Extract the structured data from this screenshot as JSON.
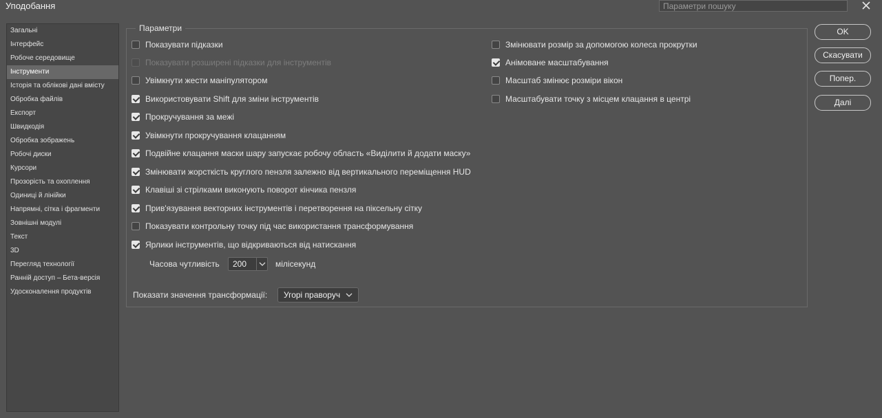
{
  "window": {
    "title": "Уподобання",
    "search_placeholder": "Параметри пошуку"
  },
  "sidebar": {
    "items": [
      {
        "label": "Загальні",
        "active": false
      },
      {
        "label": "Інтерфейс",
        "active": false
      },
      {
        "label": "Робоче середовище",
        "active": false
      },
      {
        "label": "Інструменти",
        "active": true
      },
      {
        "label": "Історія та облікові дані вмісту",
        "active": false
      },
      {
        "label": "Обробка файлів",
        "active": false
      },
      {
        "label": "Експорт",
        "active": false
      },
      {
        "label": "Швидкодія",
        "active": false
      },
      {
        "label": "Обробка зображень",
        "active": false
      },
      {
        "label": "Робочі диски",
        "active": false
      },
      {
        "label": "Курсори",
        "active": false
      },
      {
        "label": "Прозорість та охоплення",
        "active": false
      },
      {
        "label": "Одиниці й лінійки",
        "active": false
      },
      {
        "label": "Напрямні, сітка і фрагменти",
        "active": false
      },
      {
        "label": "Зовнішні модулі",
        "active": false
      },
      {
        "label": "Текст",
        "active": false
      },
      {
        "label": "3D",
        "active": false
      },
      {
        "label": "Перегляд технології",
        "active": false
      },
      {
        "label": "Ранній доступ – Бета-версія",
        "active": false
      },
      {
        "label": "Удосконалення продуктів",
        "active": false
      }
    ]
  },
  "options": {
    "group_title": "Параметри",
    "left": [
      {
        "label": "Показувати підказки",
        "checked": false,
        "disabled": false
      },
      {
        "label": "Показувати розширені підказки для інструментів",
        "checked": false,
        "disabled": true
      },
      {
        "label": "Увімкнути жести маніпулятором",
        "checked": false,
        "disabled": false
      },
      {
        "label": "Використовувати Shift для зміни інструментів",
        "checked": true,
        "disabled": false
      },
      {
        "label": "Прокручування за межі",
        "checked": true,
        "disabled": false
      },
      {
        "label": "Увімкнути прокручування клацанням",
        "checked": true,
        "disabled": false
      },
      {
        "label": "Подвійне клацання маски шару запускає робочу область «Виділити й додати маску»",
        "checked": true,
        "disabled": false
      },
      {
        "label": "Змінювати жорсткість круглого пензля залежно від вертикального переміщення HUD",
        "checked": true,
        "disabled": false
      },
      {
        "label": "Клавіші зі стрілками виконують поворот кінчика пензля",
        "checked": true,
        "disabled": false
      },
      {
        "label": "Прив'язування векторних інструментів і перетворення на піксельну сітку",
        "checked": true,
        "disabled": false
      },
      {
        "label": "Показувати контрольну точку під час використання трансформування",
        "checked": false,
        "disabled": false
      },
      {
        "label": "Ярлики інструментів, що відкриваються від натискання",
        "checked": true,
        "disabled": false
      }
    ],
    "right": [
      {
        "label": "Змінювати розмір за допомогою колеса прокрутки",
        "checked": false,
        "disabled": false
      },
      {
        "label": "Анімоване масштабування",
        "checked": true,
        "disabled": false
      },
      {
        "label": "Масштаб змінює розміри вікон",
        "checked": false,
        "disabled": false
      },
      {
        "label": "Масштабувати точку з місцем клацання в центрі",
        "checked": false,
        "disabled": false
      }
    ],
    "sensitivity_label": "Часова чутливість",
    "sensitivity_value": "200",
    "sensitivity_unit": "мілісекунд",
    "transform_label": "Показати значення трансформації:",
    "transform_value": "Угорі праворуч"
  },
  "buttons": {
    "ok": "OK",
    "cancel": "Скасувати",
    "prev": "Попер.",
    "next": "Далі"
  },
  "icons": {
    "close": "close-icon",
    "dropdown": "chevron-down-icon",
    "checkmark": "checkmark-icon"
  }
}
